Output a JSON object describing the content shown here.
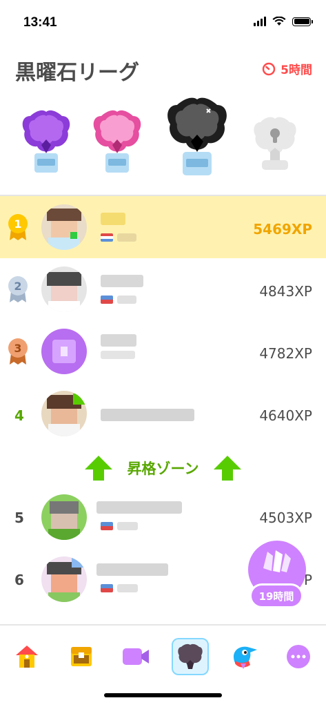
{
  "status_bar": {
    "time": "13:41"
  },
  "header": {
    "title": "黒曜石リーグ",
    "timer": "5時間"
  },
  "league_badges": [
    "amethyst-badge",
    "pearl-badge",
    "obsidian-badge",
    "diamond-locked-badge"
  ],
  "leaderboard": [
    {
      "rank": "1",
      "xp": "5469XP",
      "current_user": true
    },
    {
      "rank": "2",
      "xp": "4843XP"
    },
    {
      "rank": "3",
      "xp": "4782XP"
    },
    {
      "rank": "4",
      "xp": "4640XP"
    },
    {
      "rank": "5",
      "xp": "4503XP"
    },
    {
      "rank": "6",
      "xp": "P"
    }
  ],
  "promotion_zone": {
    "label": "昇格ゾーン"
  },
  "chest": {
    "timer": "19時間"
  },
  "nav": [
    "home-icon",
    "treasure-chest-icon",
    "video-icon",
    "league-icon",
    "bird-icon",
    "more-icon"
  ],
  "colors": {
    "accent_gold": "#f0a500",
    "promotion_green": "#58a700",
    "timer_red": "#ff4b4b",
    "highlight": "#fff2b0",
    "chest_purple": "#ce82ff"
  }
}
